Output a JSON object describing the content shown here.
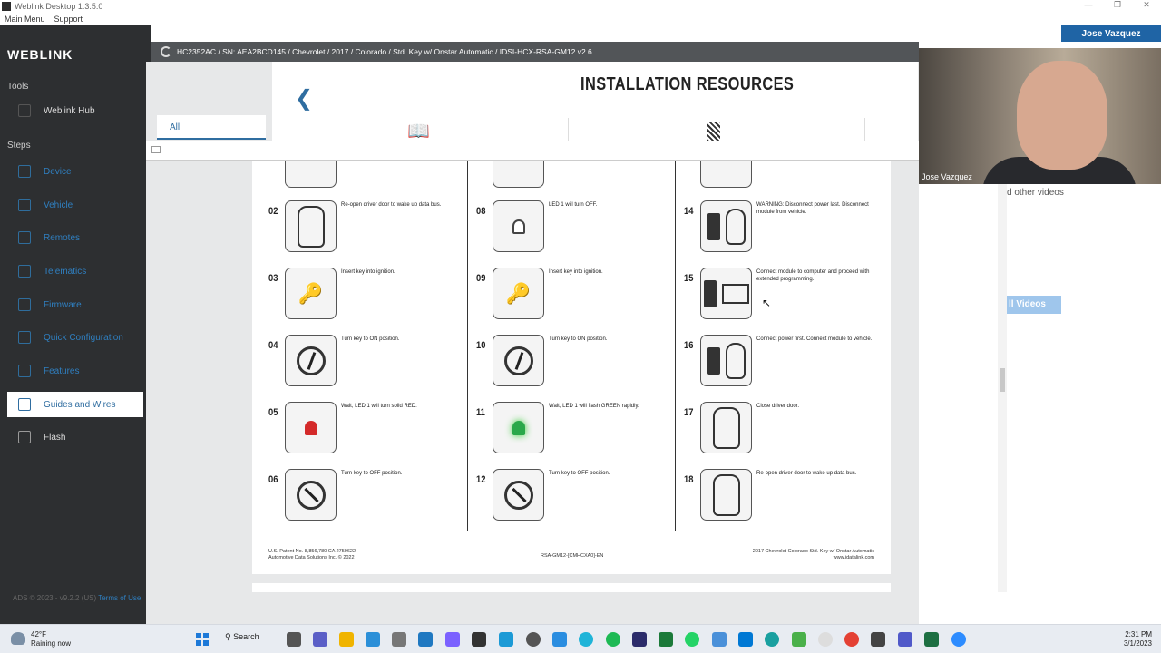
{
  "window": {
    "title": "Weblink Desktop 1.3.5.0",
    "menu": [
      "Main Menu",
      "Support"
    ]
  },
  "sidebar": {
    "logo": "WEBLINK",
    "tools_heading": "Tools",
    "hub": "Weblink Hub",
    "steps_heading": "Steps",
    "items": [
      "Device",
      "Vehicle",
      "Remotes",
      "Telematics",
      "Firmware",
      "Quick Configuration",
      "Features",
      "Guides and Wires",
      "Flash"
    ],
    "active": "Guides and Wires",
    "footer_text": "ADS © 2023 - v9.2.2 (US)",
    "footer_link": "Terms of Use"
  },
  "header": {
    "vehicle_path": "HC2352AC / SN: AEA2BCD145 / Chevrolet / 2017 / Colorado / Std. Key w/ Onstar Automatic / IDSI-HCX-RSA-GM12 v2.6",
    "user": "Jose Vazquez"
  },
  "resources": {
    "tab_all": "All",
    "title": "INSTALLATION RESOURCES"
  },
  "guide": {
    "steps": [
      {
        "num": "02",
        "text": "Re-open driver door to wake up data bus.",
        "pic": "car"
      },
      {
        "num": "03",
        "text": "Insert key into ignition.",
        "pic": "key"
      },
      {
        "num": "04",
        "text": "Turn key to ON position.",
        "pic": "dial-on"
      },
      {
        "num": "05",
        "text": "Wait, LED 1 will turn solid RED.",
        "pic": "led-red"
      },
      {
        "num": "06",
        "text": "Turn key to OFF position.",
        "pic": "dial-off"
      },
      {
        "num": "08",
        "text": "LED 1 will turn OFF.",
        "pic": "led-off"
      },
      {
        "num": "09",
        "text": "Insert key into ignition.",
        "pic": "key"
      },
      {
        "num": "10",
        "text": "Turn key to ON position.",
        "pic": "dial-on"
      },
      {
        "num": "11",
        "text": "Wait, LED 1 will flash GREEN rapidly.",
        "pic": "led-green"
      },
      {
        "num": "12",
        "text": "Turn key to OFF position.",
        "pic": "dial-off"
      },
      {
        "num": "14",
        "text": "WARNING: Disconnect power last. Disconnect module from vehicle.",
        "pic": "module-car"
      },
      {
        "num": "15",
        "text": "Connect module to computer and proceed with extended programming.",
        "pic": "module-laptop"
      },
      {
        "num": "16",
        "text": "Connect power first. Connect module to vehicle.",
        "pic": "module-car"
      },
      {
        "num": "17",
        "text": "Close driver door.",
        "pic": "car"
      },
      {
        "num": "18",
        "text": "Re-open driver door to wake up data bus.",
        "pic": "car"
      }
    ],
    "footer_left_1": "U.S. Patent No. 8,856,780 CA 2759622",
    "footer_left_2": "Automotive Data Solutions Inc. © 2022",
    "footer_mid": "RSA-GM12-[CMHCXA0]-EN",
    "footer_right_1": "2017 Chevrolet Colorado Std. Key w/ Onstar   Automatic",
    "footer_right_2": "www.idatalink.com"
  },
  "right_panel": {
    "other_videos": "d other videos",
    "all_videos": "ll Videos"
  },
  "video": {
    "participant": "Jose Vazquez"
  },
  "taskbar": {
    "temp": "42°F",
    "weather": "Raining now",
    "search": "Search",
    "time": "2:31 PM",
    "date": "3/1/2023"
  }
}
